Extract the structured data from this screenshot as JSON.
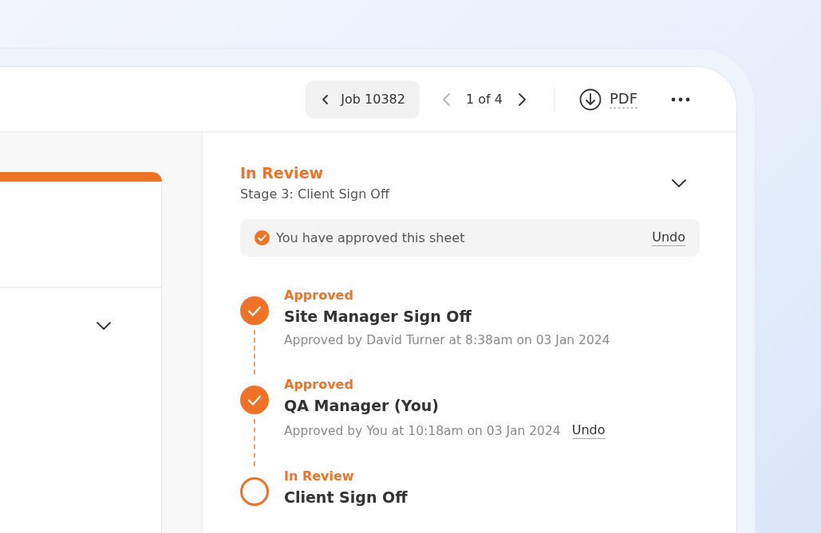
{
  "header": {
    "back_button": "Job 10382",
    "pager": {
      "text": "1 of 4",
      "prev_disabled": true,
      "next_disabled": false
    },
    "pdf_button": "PDF"
  },
  "left_panel": {
    "section_expanded": false
  },
  "review": {
    "status": "In Review",
    "stage": "Stage 3: Client Sign Off",
    "expanded": false
  },
  "banner": {
    "text": "You have approved this sheet",
    "action": "Undo"
  },
  "steps": [
    {
      "kind": "approved",
      "status": "Approved",
      "title": "Site Manager Sign Off",
      "detail": "Approved by David Turner at 8:38am on 03 Jan 2024"
    },
    {
      "kind": "approved",
      "status": "Approved",
      "title": "QA Manager (You)",
      "detail": "Approved by You at 10:18am on 03 Jan 2024",
      "action": "Undo"
    },
    {
      "kind": "review",
      "status": "In Review",
      "title": "Client Sign Off"
    }
  ]
}
